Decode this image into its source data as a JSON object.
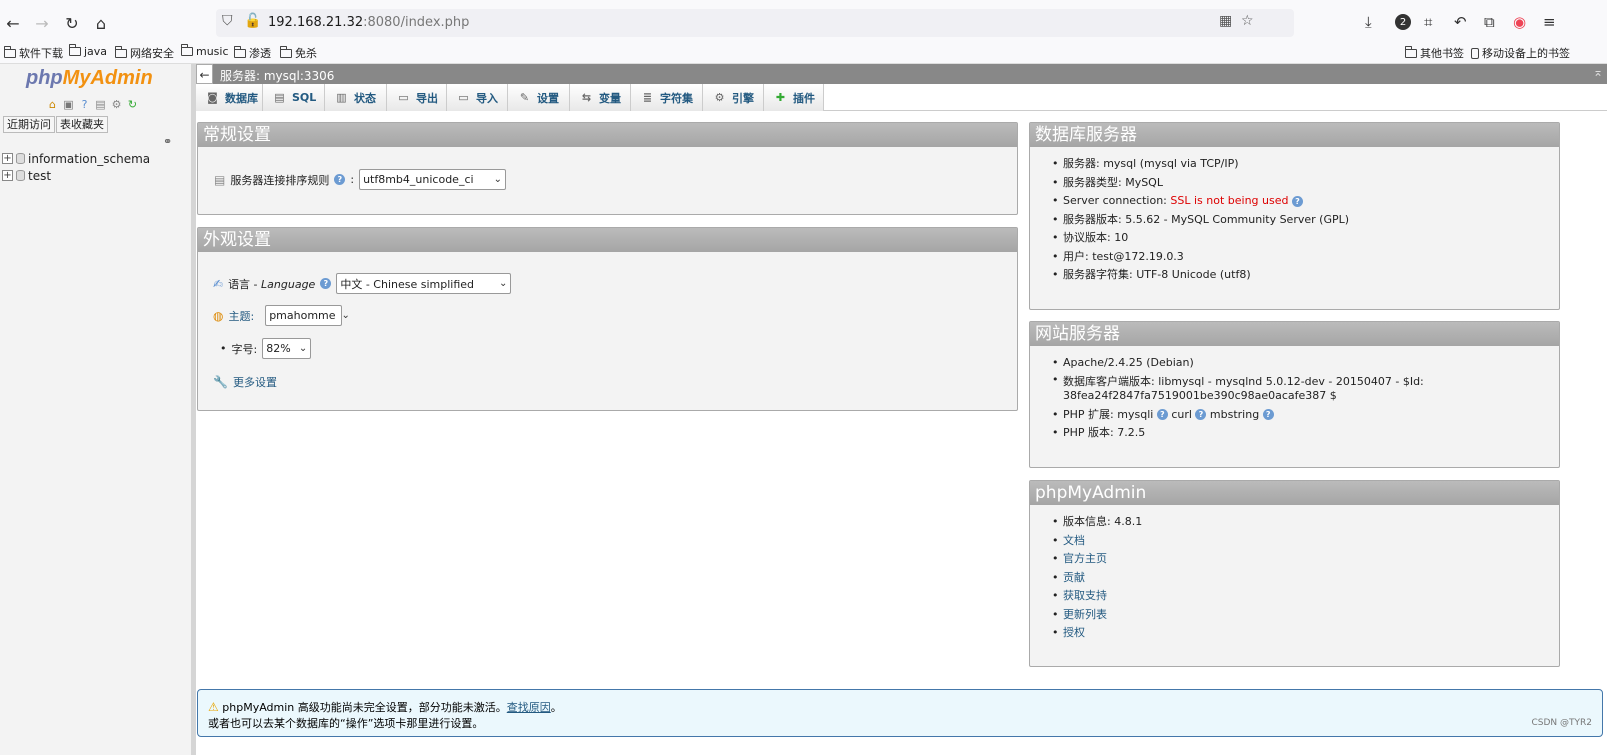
{
  "browser": {
    "url_host": "192.168.21.32",
    "url_path": ":8080/index.php",
    "bookmarks": [
      "软件下载",
      "java",
      "网络安全",
      "music",
      "渗透",
      "免杀"
    ],
    "bookmarks_right": [
      "其他书签",
      "移动设备上的书签"
    ],
    "badge_count": "2"
  },
  "nav": {
    "logo_php": "php",
    "logo_myadmin": "MyAdmin",
    "recent_label": "近期访问",
    "favorites_label": "表收藏夹",
    "databases": [
      "information_schema",
      "test"
    ]
  },
  "serverbar": {
    "crumb": "服务器: mysql:3306"
  },
  "tabs": [
    {
      "label": "数据库",
      "icon": "database-icon"
    },
    {
      "label": "SQL",
      "icon": "sql-icon"
    },
    {
      "label": "状态",
      "icon": "status-icon"
    },
    {
      "label": "导出",
      "icon": "export-icon"
    },
    {
      "label": "导入",
      "icon": "import-icon"
    },
    {
      "label": "设置",
      "icon": "settings-icon"
    },
    {
      "label": "变量",
      "icon": "variables-icon"
    },
    {
      "label": "字符集",
      "icon": "charset-icon"
    },
    {
      "label": "引擎",
      "icon": "engine-icon"
    },
    {
      "label": "插件",
      "icon": "plugin-icon"
    }
  ],
  "general": {
    "title": "常规设置",
    "collation_label": "服务器连接排序规则",
    "collation_value": "utf8mb4_unicode_ci"
  },
  "appearance": {
    "title": "外观设置",
    "language_label": "语言 - ",
    "language_label_italic": "Language",
    "language_value": "中文 - Chinese simplified",
    "theme_label": "主题:",
    "theme_value": "pmahomme",
    "fontsize_label": "字号:",
    "fontsize_value": "82%",
    "more_settings": "更多设置"
  },
  "db_server": {
    "title": "数据库服务器",
    "items": [
      {
        "label": "服务器: ",
        "value": "mysql (mysql via TCP/IP)"
      },
      {
        "label": "服务器类型: ",
        "value": "MySQL"
      },
      {
        "label": "Server connection: ",
        "value": "SSL is not being used"
      },
      {
        "label": "服务器版本: ",
        "value": "5.5.62 - MySQL Community Server (GPL)"
      },
      {
        "label": "协议版本: ",
        "value": "10"
      },
      {
        "label": "用户: ",
        "value": "test@172.19.0.3"
      },
      {
        "label": "服务器字符集: ",
        "value": "UTF-8 Unicode (utf8)"
      }
    ]
  },
  "web_server": {
    "title": "网站服务器",
    "apache": "Apache/2.4.25 (Debian)",
    "client_label": "数据库客户端版本: ",
    "client_value_1": "libmysql - mysqlnd 5.0.12-dev - 20150407 - $Id:",
    "client_value_2": "38fea24f2847fa7519001be390c98ae0acafe387 $",
    "php_ext_label": "PHP 扩展: ",
    "php_ext_1": "mysqli",
    "php_ext_2": "curl",
    "php_ext_3": "mbstring",
    "php_version_label": "PHP 版本: ",
    "php_version_value": "7.2.5"
  },
  "pma": {
    "title": "phpMyAdmin",
    "version_label": "版本信息: ",
    "version_value": "4.8.1",
    "links": [
      "文档",
      "官方主页",
      "贡献",
      "获取支持",
      "更新列表",
      "授权"
    ]
  },
  "notice": {
    "line1": "phpMyAdmin 高级功能尚未完全设置，部分功能未激活。",
    "link": "查找原因",
    "line1_end": "。",
    "line2": "或者也可以去某个数据库的“操作”选项卡那里进行设置。",
    "watermark": "CSDN @TYR2"
  },
  "colors": {
    "link": "#235a81",
    "logo_php": "#6c78af",
    "logo_myadmin": "#f29111",
    "warning": "#dd0000"
  }
}
